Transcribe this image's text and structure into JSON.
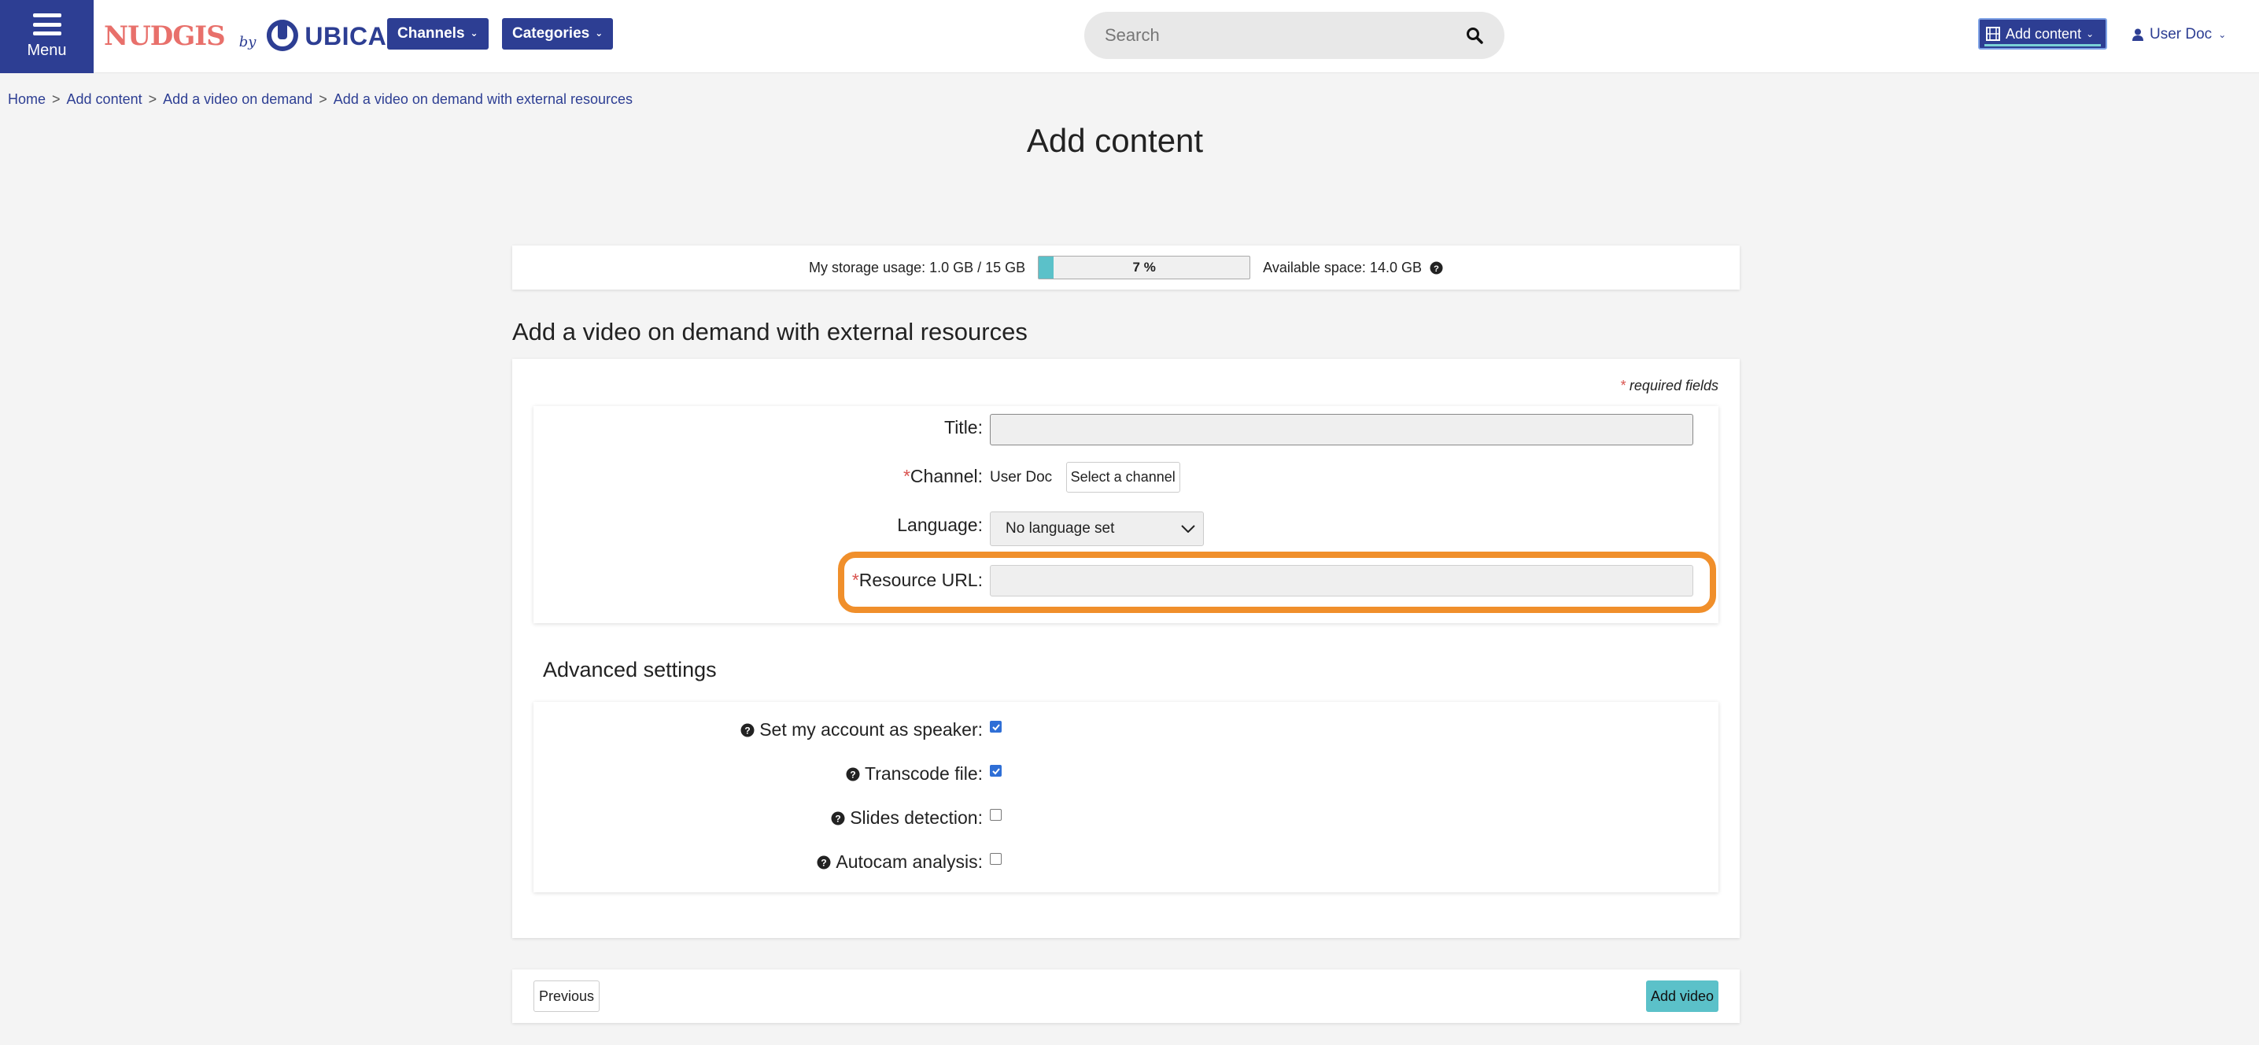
{
  "header": {
    "menu_label": "Menu",
    "logo_left": "NUDGIS",
    "logo_by": "by",
    "logo_right": "UBICAST",
    "channels_label": "Channels",
    "categories_label": "Categories",
    "search_placeholder": "Search",
    "add_content_label": "Add content",
    "user_label": "User Doc"
  },
  "breadcrumb": [
    "Home",
    "Add content",
    "Add a video on demand",
    "Add a video on demand with external resources"
  ],
  "page_title": "Add content",
  "storage": {
    "usage_label": "My storage usage: 1.0 GB / 15 GB",
    "percent": 7,
    "percent_label": "7 %",
    "available_label": "Available space: 14.0 GB"
  },
  "form": {
    "section_title": "Add a video on demand with external resources",
    "required_note_star": "*",
    "required_note": " required fields",
    "fields": {
      "title_label": "Title:",
      "title_value": "",
      "channel_star": "*",
      "channel_label": "Channel:",
      "channel_user": "User Doc",
      "channel_button": "Select a channel",
      "language_label": "Language:",
      "language_value": "No language set",
      "resource_star": "*",
      "resource_label": "Resource URL:",
      "resource_value": ""
    },
    "advanced": {
      "title": "Advanced settings",
      "options": [
        {
          "label": "Set my account as speaker:",
          "checked": true
        },
        {
          "label": "Transcode file:",
          "checked": true
        },
        {
          "label": "Slides detection:",
          "checked": false
        },
        {
          "label": "Autocam analysis:",
          "checked": false
        }
      ]
    }
  },
  "footer": {
    "previous_label": "Previous",
    "add_video_label": "Add video"
  },
  "colors": {
    "brand_blue": "#2d3e93",
    "nudgis_coral": "#e8706b",
    "teal": "#5bc1c9",
    "highlight_orange": "#f08f2b",
    "required_red": "#d9534f"
  },
  "icons": [
    "menu-icon",
    "ubicast-logo-icon",
    "chevron-down-icon",
    "search-icon",
    "film-icon",
    "user-icon",
    "question-circle-icon",
    "checkmark-icon",
    "caret-down-icon"
  ]
}
